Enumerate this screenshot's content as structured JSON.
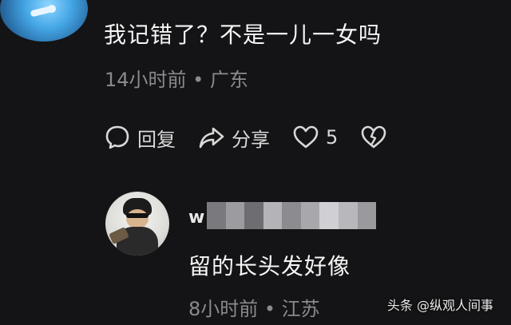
{
  "comment": {
    "text": "我记错了？不是一儿一女吗",
    "meta": "14小时前 • 广东",
    "actions": {
      "reply_label": "回复",
      "share_label": "分享",
      "like_count": "5"
    },
    "icons": [
      "comment-icon",
      "share-icon",
      "heart-icon",
      "broken-heart-icon"
    ]
  },
  "reply": {
    "name_visible": "w",
    "text": "留的长头发好像",
    "meta": "8小时前 • 江苏"
  },
  "watermark": {
    "text": "头条 @纵观人间事"
  },
  "colors": {
    "background": "#141416",
    "primary_text": "#f5f5f5",
    "secondary_text": "#8a8a8e"
  }
}
